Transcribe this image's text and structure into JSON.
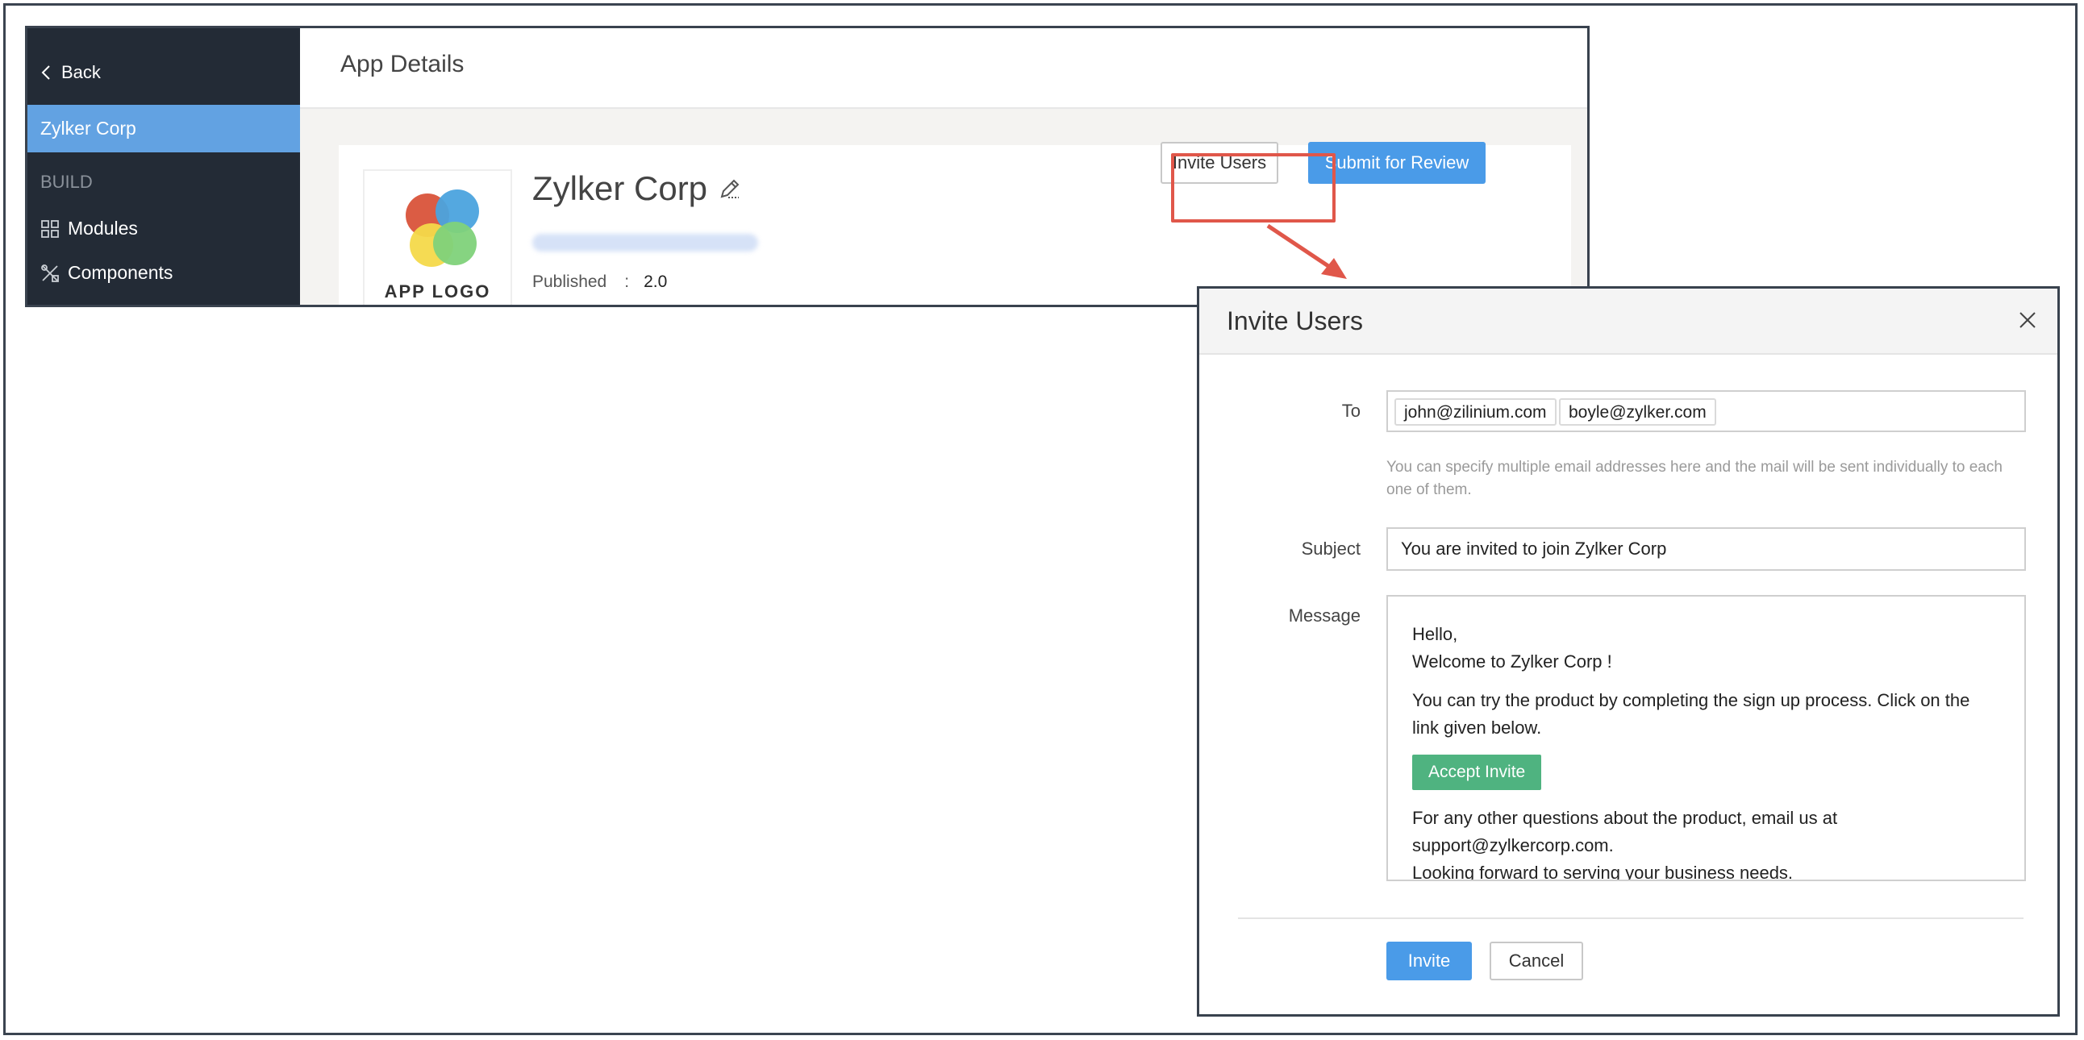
{
  "sidebar": {
    "back_label": "Back",
    "active_item": "Zylker Corp",
    "section_label": "BUILD",
    "items": [
      {
        "label": "Modules",
        "icon": "modules-icon"
      },
      {
        "label": "Components",
        "icon": "components-icon"
      }
    ]
  },
  "header": {
    "title": "App Details"
  },
  "app": {
    "logo_caption": "APP LOGO",
    "name": "Zylker Corp",
    "published_label": "Published",
    "published_separator": ":",
    "published_version": "2.0"
  },
  "actions": {
    "invite_users_label": "Invite Users",
    "submit_review_label": "Submit for Review"
  },
  "dialog": {
    "title": "Invite Users",
    "to_label": "To",
    "recipients": [
      "john@zilinium.com",
      "boyle@zylker.com"
    ],
    "hint": "You can specify multiple email addresses here and the mail will be sent individually to each one of them.",
    "subject_label": "Subject",
    "subject_value": "You are invited to join Zylker Corp",
    "message_label": "Message",
    "message": {
      "greeting": "Hello,",
      "welcome": "Welcome to Zylker Corp !",
      "body": "You can try the product by completing the sign up process. Click on the link given below.",
      "accept_label": "Accept Invite",
      "questions": "For any other questions about the product, email us at support@zylkercorp.com.",
      "closing": "Looking forward to serving your business needs."
    },
    "invite_label": "Invite",
    "cancel_label": "Cancel"
  },
  "colors": {
    "sidebar_bg": "#232b36",
    "sidebar_active": "#62a2e2",
    "primary": "#4a9be8",
    "accept_green": "#4fb380",
    "highlight_red": "#e0574a"
  }
}
